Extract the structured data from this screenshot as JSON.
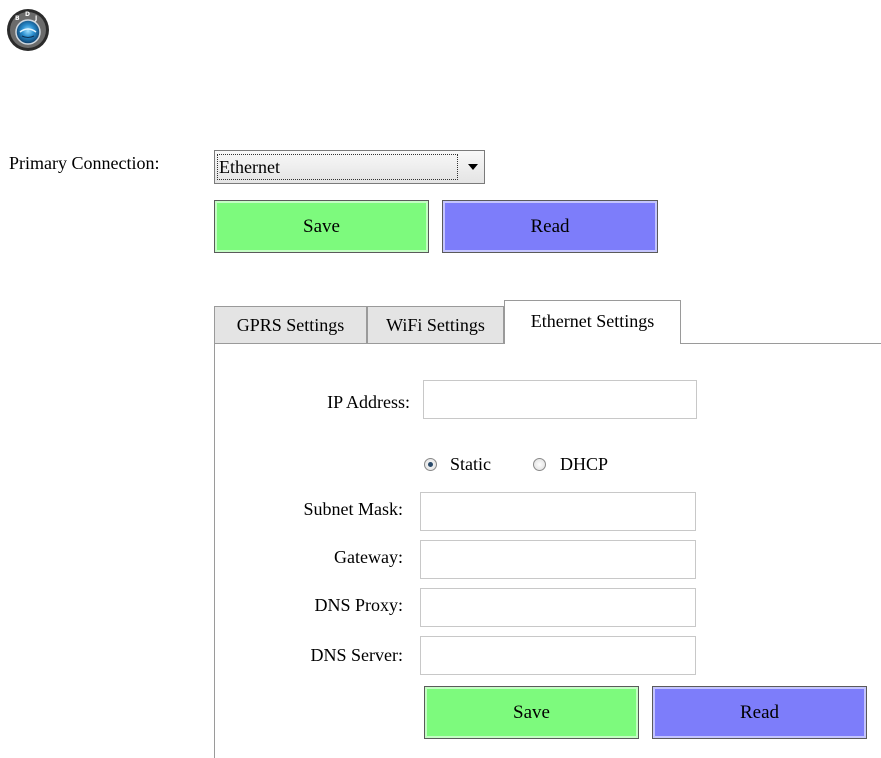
{
  "logo": {
    "letters": "B D J"
  },
  "primary_connection": {
    "label": "Primary Connection:",
    "selected": "Ethernet",
    "save_label": "Save",
    "read_label": "Read"
  },
  "tabs": [
    {
      "label": "GPRS Settings",
      "active": false
    },
    {
      "label": "WiFi Settings",
      "active": false
    },
    {
      "label": "Ethernet Settings",
      "active": true
    }
  ],
  "ethernet": {
    "ip_label": "IP Address:",
    "ip_value": "",
    "mode": {
      "static_label": "Static",
      "dhcp_label": "DHCP",
      "selected": "Static"
    },
    "subnet_label": "Subnet Mask:",
    "subnet_value": "",
    "gateway_label": "Gateway:",
    "gateway_value": "",
    "dns_proxy_label": "DNS Proxy:",
    "dns_proxy_value": "",
    "dns_server_label": "DNS Server:",
    "dns_server_value": "",
    "save_label": "Save",
    "read_label": "Read"
  },
  "colors": {
    "save": "#7dfa7d",
    "read": "#7d7dfa",
    "tab_inactive": "#e4e4e4"
  }
}
